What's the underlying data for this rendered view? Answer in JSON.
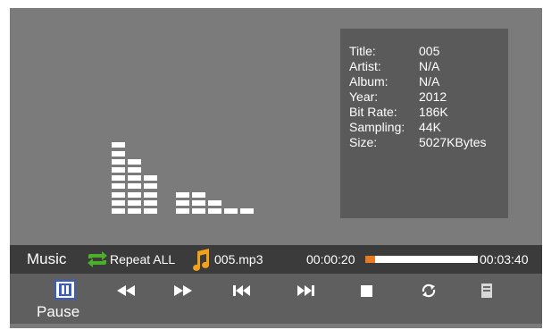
{
  "info": {
    "rows": [
      {
        "key": "Title:",
        "value": "005"
      },
      {
        "key": "Artist:",
        "value": "N/A"
      },
      {
        "key": "Album:",
        "value": "N/A"
      },
      {
        "key": "Year:",
        "value": "2012"
      },
      {
        "key": "Bit Rate:",
        "value": "186K"
      },
      {
        "key": "Sampling:",
        "value": "44K"
      },
      {
        "key": "Size:",
        "value": "5027KBytes"
      }
    ]
  },
  "visualizer": {
    "levels": [
      0,
      9,
      7,
      5,
      0,
      3,
      3,
      2,
      1,
      1
    ]
  },
  "status": {
    "mode_label": "Music",
    "repeat_label": "Repeat ALL",
    "file_name": "005.mp3",
    "time_current": "00:00:20",
    "time_total": "00:03:40",
    "progress_fraction": 0.09
  },
  "controls": {
    "pause_label": "Pause",
    "buttons": [
      "pause-icon",
      "rewind-icon",
      "fast-forward-icon",
      "previous-track-icon",
      "next-track-icon",
      "stop-icon",
      "repeat-cycle-icon",
      "playlist-icon"
    ]
  },
  "colors": {
    "screen_bg": "#7b7b7b",
    "panel_bg": "#5a5a5a",
    "bar_bg": "#3b3b3b",
    "progress_fill": "#e87a22",
    "selection_border": "#3a5cc7",
    "repeat_icon": "#4caf2a",
    "note_icon": "#f2a11a"
  }
}
